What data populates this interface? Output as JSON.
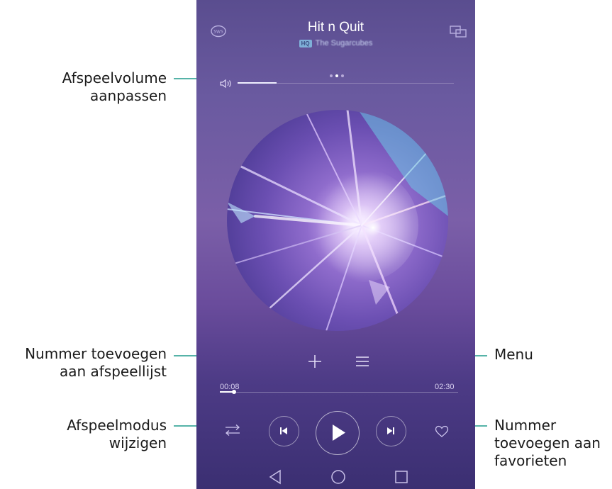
{
  "screen": {
    "title": "Hit n Quit",
    "hq_badge": "HQ",
    "artist": "The Sugarcubes",
    "time_elapsed": "00:08",
    "time_total": "02:30",
    "volume_level": 0.18,
    "progress_fraction": 0.06,
    "pager": {
      "count": 3,
      "active_index": 1
    }
  },
  "callouts": {
    "volume": "Afspeelvolume\naanpassen",
    "add_playlist": "Nummer toevoegen\naan afspeellijst",
    "play_mode": "Afspeelmodus\nwijzigen",
    "menu": "Menu",
    "favorites": "Nummer\ntoevoegen aan\nfavorieten"
  },
  "icons": {
    "top_left": "sound-effects-icon",
    "top_right": "screen-cast-icon",
    "volume": "speaker-icon",
    "add": "plus-icon",
    "menu": "menu-lines-icon",
    "shuffle": "play-mode-icon",
    "prev": "skip-previous-icon",
    "play": "play-icon",
    "next": "skip-next-icon",
    "favorite": "heart-icon",
    "back": "nav-back-icon",
    "home": "nav-home-icon",
    "recents": "nav-recents-icon"
  },
  "colors": {
    "accent_leader": "#56b3a8",
    "background_top": "#5a4d8f",
    "background_bottom": "#3b2f72"
  }
}
